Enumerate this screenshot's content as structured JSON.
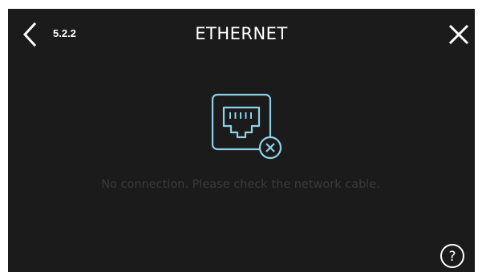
{
  "header": {
    "section_number": "5.2.2",
    "title": "ETHERNET",
    "back_icon": "chevron-left-icon",
    "close_icon": "close-icon"
  },
  "main": {
    "status_icon": "ethernet-disconnected-icon",
    "message": "No connection. Please check the network cable."
  },
  "footer": {
    "help_label": "?",
    "help_icon": "help-icon"
  },
  "colors": {
    "background": "#1b1b1b",
    "foreground": "#ffffff",
    "accent": "#8ed0e6",
    "muted_text": "#3a3a3a"
  }
}
